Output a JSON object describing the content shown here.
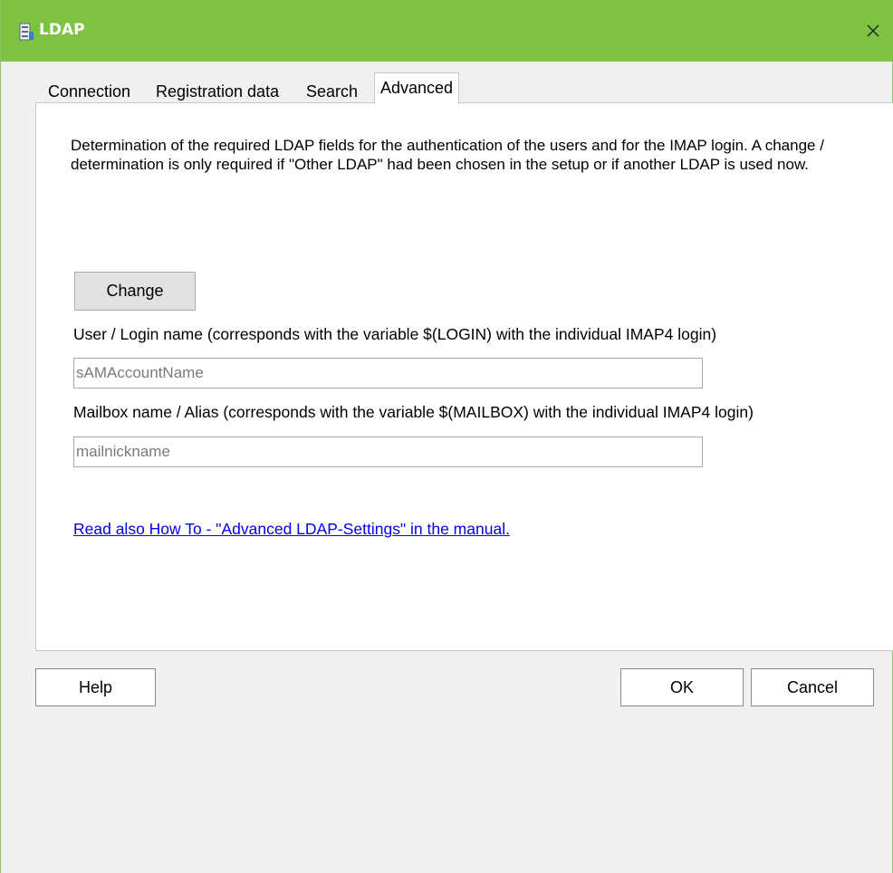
{
  "window": {
    "title": "LDAP",
    "icons": {
      "app": "database-icon",
      "close": "close-icon"
    }
  },
  "tabs": [
    {
      "label": "Connection",
      "active": false
    },
    {
      "label": "Registration data",
      "active": false
    },
    {
      "label": "Search",
      "active": false
    },
    {
      "label": "Advanced",
      "active": true
    }
  ],
  "advanced": {
    "description": "Determination of the required LDAP fields for the authentication of the users and for the IMAP login. A change / determination is only required if \"Other LDAP\" had been chosen in the setup or if another LDAP is used now.",
    "change_button": "Change",
    "login_label": "User / Login name (corresponds with the variable $(LOGIN) with the individual IMAP4 login)",
    "login_value": "sAMAccountName",
    "mailbox_label": "Mailbox name / Alias (corresponds with the variable $(MAILBOX) with the individual IMAP4 login)",
    "mailbox_value": "mailnickname",
    "manual_link": "Read also How To - \"Advanced LDAP-Settings\" in the manual."
  },
  "footer": {
    "help": "Help",
    "ok": "OK",
    "cancel": "Cancel"
  },
  "colors": {
    "titlebar": "#7ec242",
    "link": "#0000ee"
  }
}
